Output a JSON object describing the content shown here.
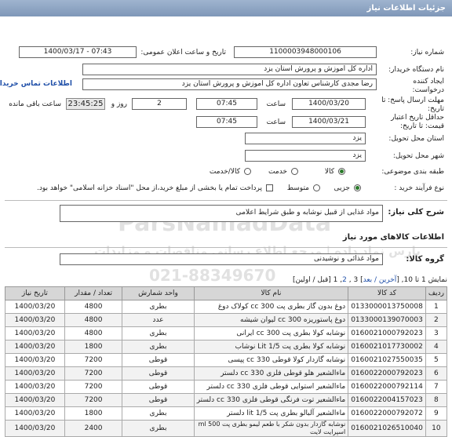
{
  "title": "جزئیات اطلاعات نیاز",
  "form": {
    "need_number_label": "شماره نیاز:",
    "need_number": "1100003948000106",
    "announce_label": "تاریخ و ساعت اعلان عمومی:",
    "announce_value": "1400/03/17 - 07:43",
    "buyer_label": "نام دستگاه خریدار:",
    "buyer_value": "اداره کل اموزش و پرورش استان یزد",
    "creator_label": "ایجاد کننده درخواست:",
    "creator_value": "رضا مجدی کارشناس تعاون اداره کل اموزش و پرورش استان یزد",
    "contact_link": "اطلاعات تماس خریدار",
    "reply_deadline_label": "مهلت ارسال پاسخ: تا تاریخ:",
    "reply_date": "1400/03/20",
    "time_label": "ساعت",
    "reply_time": "07:45",
    "days_value": "2",
    "days_label": "روز و",
    "remaining_time": "23:45:25",
    "remaining_label": "ساعت باقی مانده",
    "price_deadline_label": "حداقل تاریخ اعتبار قیمت: تا تاریخ:",
    "price_date": "1400/03/21",
    "price_time": "07:45",
    "province_label": "استان محل تحویل:",
    "province_value": "یزد",
    "city_label": "شهر محل تحویل:",
    "city_value": "یزد",
    "category_label": "طبقه بندی موضوعی:",
    "cat_goods": "کالا",
    "cat_service": "خدمت",
    "cat_goods_service": "کالا/خدمت",
    "process_label": "نوع فرآیند خرید :",
    "proc_minor": "جزیی",
    "proc_medium": "متوسط",
    "payment_text": "پرداخت تمام یا بخشی از مبلغ خرید،از محل \"اسناد خزانه اسلامی\" خواهد بود."
  },
  "summary": {
    "label": "شرح کلی نیاز:",
    "value": "مواد غذایی از قبیل نوشابه و طبق شرایط اعلامی"
  },
  "goods_section": {
    "title": "اطلاعات کالاهای مورد نیاز"
  },
  "goods_group": {
    "label": "گروه کالا:",
    "value": "مواد غذائی و نوشیدنی"
  },
  "pagination": {
    "text_prefix": "نمایش 1 تا 10, [",
    "last_next": "آخرین / بعد",
    "text_mid": "] 3 ,",
    "page2": "2",
    "text_mid2": ",",
    "page1": "1",
    "text_suffix": "[قبل / اولین]"
  },
  "watermark": {
    "brand": "ParsNamadData",
    "tagline": "پارس نماد داده | مرجع اطلاع رسانی مناقصات و مزایدات",
    "phone": "021-88349670"
  },
  "table": {
    "headers": [
      "ردیف",
      "کد کالا",
      "نام کالا",
      "واحد شمارش",
      "تعداد / مقدار",
      "تاریخ نیاز"
    ],
    "rows": [
      [
        "1",
        "0133000013750008",
        "دوغ بدون گاز بطری پت 300 cc کولاک دوغ",
        "بطری",
        "4800",
        "1400/03/20"
      ],
      [
        "2",
        "0133000139070003",
        "دوغ پاستوریزه 300 cc لیوان شیشه",
        "عدد",
        "4800",
        "1400/03/20"
      ],
      [
        "3",
        "0160021000792023",
        "نوشابه کولا بطری پت 300 cc ایرانی",
        "بطری",
        "4800",
        "1400/03/20"
      ],
      [
        "4",
        "0160021017730002",
        "نوشابه کولا بطری پت 1/5 Lit نوشاب",
        "بطری",
        "1800",
        "1400/03/20"
      ],
      [
        "5",
        "0160021027550035",
        "نوشابه گازدار کولا قوطی 330 cc پپسی",
        "قوطی",
        "7200",
        "1400/03/20"
      ],
      [
        "6",
        "0160022000792023",
        "ماءالشعیر هلو قوطی فلزی 330 cc دلستر",
        "قوطی",
        "7200",
        "1400/03/20"
      ],
      [
        "7",
        "0160022000792114",
        "ماءالشعیر استوایی قوطی فلزی 330 cc دلستر",
        "قوطی",
        "7200",
        "1400/03/20"
      ],
      [
        "8",
        "0160022004157023",
        "ماءالشعیر توت فرنگی قوطی فلزی 330 cc دلستر",
        "قوطی",
        "7200",
        "1400/03/20"
      ],
      [
        "9",
        "0160022000792072",
        "ماءالشعیر آلبالو بطری پت 1/5 lit دلستر",
        "بطری",
        "1800",
        "1400/03/20"
      ],
      [
        "10",
        "0160021026510040",
        "نوشابه گازدار بدون شکر با طعم لیمو بطری پت 500 ml اسپرایت لایت",
        "بطری",
        "2400",
        "1400/03/20"
      ]
    ]
  },
  "colors": {
    "titlebar": "#8fa6c4",
    "link": "#1f4fa8",
    "radio_on": "#2a7a2a"
  }
}
